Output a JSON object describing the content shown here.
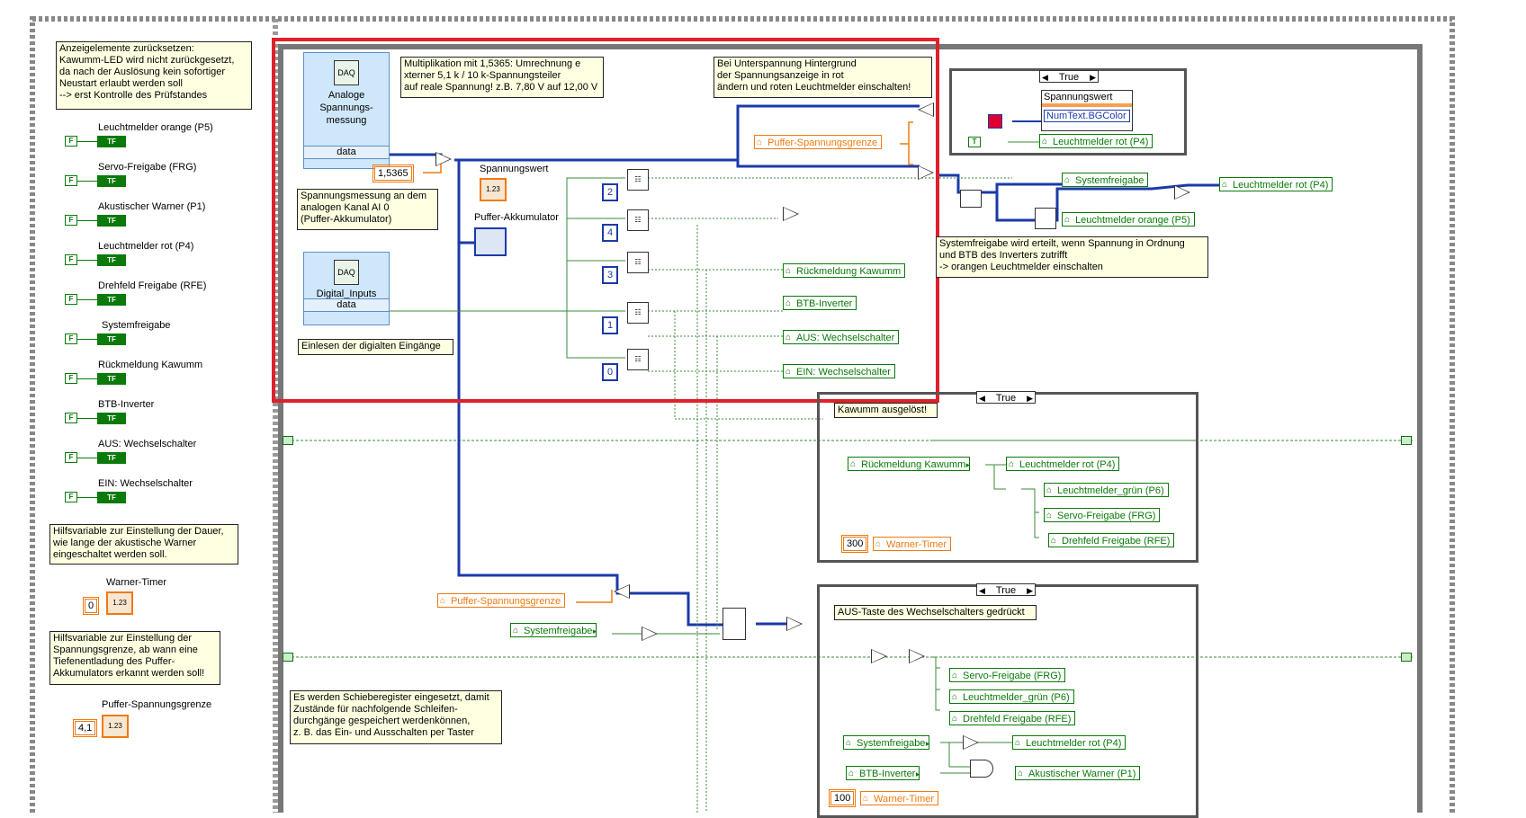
{
  "front_panel": {
    "reset_note": "Anzeigelemente zurücksetzen:\nKawumm-LED wird nicht zurückgesetzt,\nda nach der Auslösung kein sofortiger\nNeustart erlaubt werden soll\n--> erst Kontrolle des Prüfstandes",
    "controls": [
      "Leuchtmelder orange (P5)",
      "Servo-Freigabe (FRG)",
      "Akustischer Warner (P1)",
      "Leuchtmelder rot (P4)",
      "Drehfeld Freigabe (RFE)",
      "Systemfreigabe",
      "Rückmeldung Kawumm",
      "BTB-Inverter",
      "AUS: Wechselschalter",
      "EIN: Wechselschalter"
    ],
    "bool_const": "F",
    "bool_term": "TF",
    "timer_note": "Hilfsvariable zur Einstellung der Dauer,\nwie lange der akustische Warner\neingeschaltet werden soll.",
    "timer_label": "Warner-Timer",
    "timer_value": "0",
    "limit_note": "Hilfsvariable zur Einstellung der\nSpannungsgrenze, ab wann eine\nTiefenentladung des Puffer-\nAkkumulators erkannt werden soll!",
    "limit_label": "Puffer-Spannungsgrenze",
    "limit_value": "4,1",
    "numeric_icon": "1.23"
  },
  "diagram": {
    "daq_analog_label": "Analoge\nSpannungs-\nmessung",
    "daq_digital_label": "Digital_Inputs",
    "daq_out": "data",
    "mult_note": "Multiplikation mit 1,5365: Umrechnung e\nxterner 5,1 k / 10 k-Spannungsteiler\nauf reale Spannung! z.B. 7,80 V auf 12,00 V",
    "factor": "1,5365",
    "analog_note": "Spannungsmessung an dem\nanalogen Kanal AI 0\n(Puffer-Akkumulator)",
    "digital_note": "Einlesen der digialten Eingänge",
    "spannungswert_label": "Spannungswert",
    "akku_label": "Puffer-Akkumulator",
    "under_note": "Bei Unterspannung Hintergrund\nder Spannungsanzeige in rot\nändern und roten Leuchtmelder einschalten!",
    "puffer_grenze": "Puffer-Spannungsgrenze",
    "index_constants": [
      "2",
      "4",
      "3",
      "1",
      "0"
    ],
    "locals_right": [
      "Rückmeldung Kawumm",
      "BTB-Inverter",
      "AUS: Wechselschalter",
      "EIN: Wechselschalter"
    ],
    "top_case": {
      "selector": "True",
      "prop_node": "Spannungswert",
      "prop_field": "NumText.BGColor",
      "bool_true": "T",
      "local": "Leuchtmelder rot (P4)"
    },
    "system_locals": {
      "systemfreigabe": "Systemfreigabe",
      "rot": "Leuchtmelder rot (P4)",
      "orange": "Leuchtmelder orange (P5)"
    },
    "system_note": "Systemfreigabe wird erteilt, wenn Spannung in Ordnung\nund BTB des Inverters zutrifft\n-> orangen Leuchtmelder einschalten",
    "kawumm_case": {
      "selector": "True",
      "title": "Kawumm ausgelöst!",
      "read": "Rückmeldung Kawumm",
      "writes": [
        "Leuchtmelder rot (P4)",
        "Leuchtmelder_grün (P6)",
        "Servo-Freigabe (FRG)",
        "Drehfeld Freigabe (RFE)"
      ],
      "timer_const": "300",
      "timer_local": "Warner-Timer"
    },
    "lower_locals": {
      "grenze": "Puffer-Spannungsgrenze",
      "systemfreigabe": "Systemfreigabe"
    },
    "aus_case": {
      "selector": "True",
      "title": "AUS-Taste des Wechselschalters gedrückt",
      "writes": [
        "Servo-Freigabe (FRG)",
        "Leuchtmelder_grün (P6)",
        "Drehfeld Freigabe (RFE)"
      ],
      "read_sys": "Systemfreigabe",
      "write_rot": "Leuchtmelder rot (P4)",
      "read_btb": "BTB-Inverter",
      "write_warner": "Akustischer Warner (P1)",
      "timer_const": "100",
      "timer_local": "Warner-Timer"
    },
    "shift_note": "Es werden Schieberegister eingesetzt, damit\nZustände für nachfolgende Schleifen-\ndurchgänge gespeichert werdenkönnen,\nz. B. das Ein- und Ausschalten per Taster"
  },
  "colors": {
    "highlight": "#e0202a",
    "bool_green": "#0a7a0a",
    "numeric_orange": "#f07a10",
    "wire_blue": "#1b3aa8",
    "note_bg": "#ffffe1"
  }
}
